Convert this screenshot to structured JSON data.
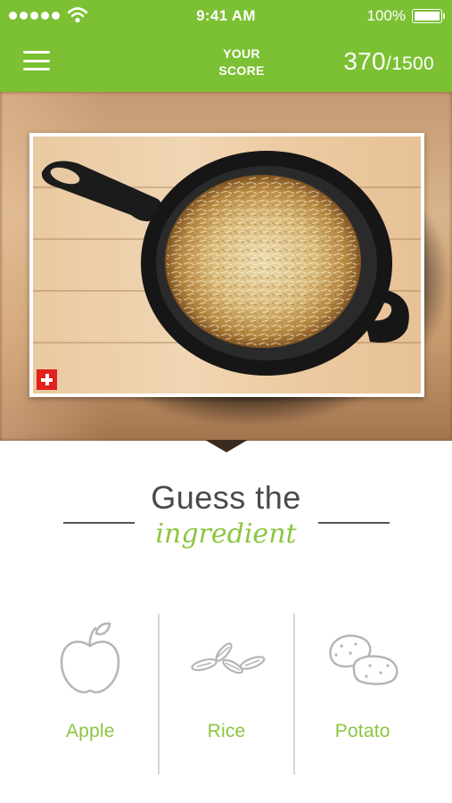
{
  "status_bar": {
    "time": "9:41 AM",
    "battery": "100%",
    "signal_dots": 5
  },
  "header": {
    "score_label_line1": "YOUR",
    "score_label_line2": "SCORE",
    "score_value": "370",
    "score_total": "/1500"
  },
  "photo": {
    "flag": "swiss-flag"
  },
  "question": {
    "line1": "Guess the",
    "line2": "ingredient"
  },
  "options": [
    {
      "label": "Apple",
      "icon": "apple-icon"
    },
    {
      "label": "Rice",
      "icon": "rice-icon"
    },
    {
      "label": "Potato",
      "icon": "potato-icon"
    }
  ],
  "colors": {
    "brand_green": "#7cc033",
    "accent_green": "#8cc63f",
    "heading_gray": "#4a4a4a"
  }
}
